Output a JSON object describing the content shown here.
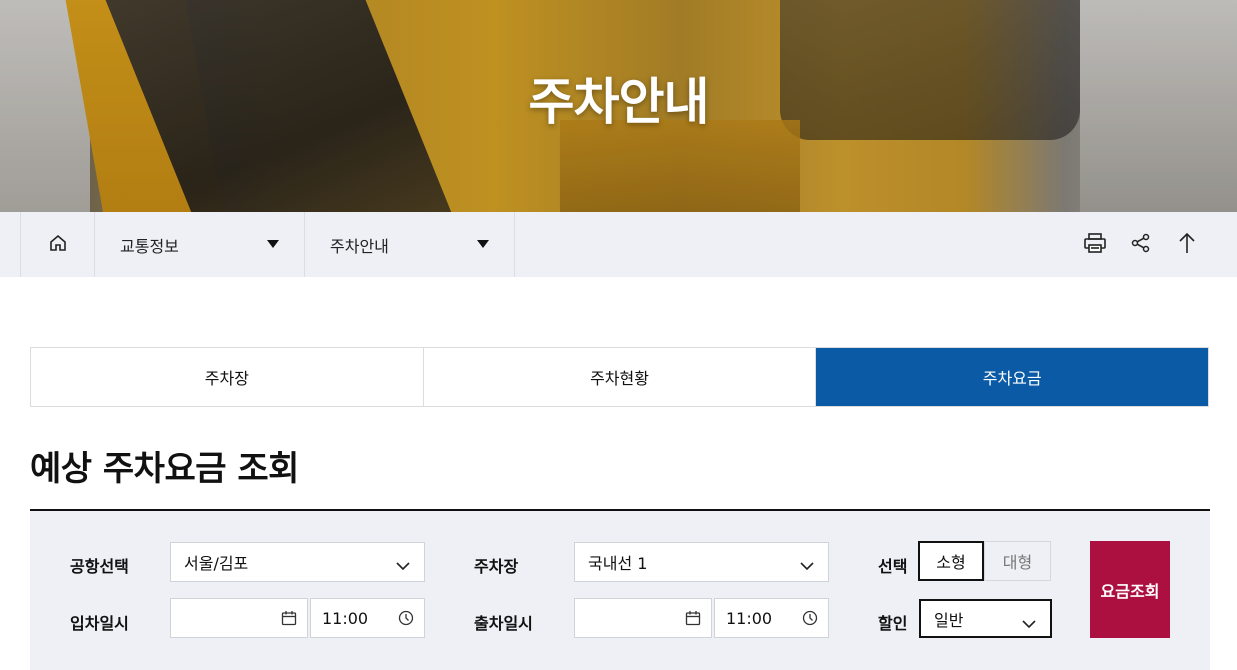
{
  "hero": {
    "title": "주차안내"
  },
  "breadcrumb": {
    "items": [
      {
        "label": "교통정보"
      },
      {
        "label": "주차안내"
      }
    ]
  },
  "tabs": [
    {
      "label": "주차장",
      "active": false
    },
    {
      "label": "주차현황",
      "active": false
    },
    {
      "label": "주차요금",
      "active": true
    }
  ],
  "section": {
    "title": "예상 주차요금 조회"
  },
  "form": {
    "airport_label": "공항선택",
    "airport_value": "서울/김포",
    "lot_label": "주차장",
    "lot_value": "국내선 1",
    "size_label": "선택",
    "size_options": [
      "소형",
      "대형"
    ],
    "size_selected": "소형",
    "entry_label": "입차일시",
    "entry_date": "",
    "entry_time": "11:00",
    "exit_label": "출차일시",
    "exit_date": "",
    "exit_time": "11:00",
    "discount_label": "할인",
    "discount_value": "일반",
    "search_button": "요금조회"
  },
  "colors": {
    "active_tab": "#0a5aa5",
    "search_button": "#ac1041",
    "panel_bg": "#eef0f5"
  }
}
